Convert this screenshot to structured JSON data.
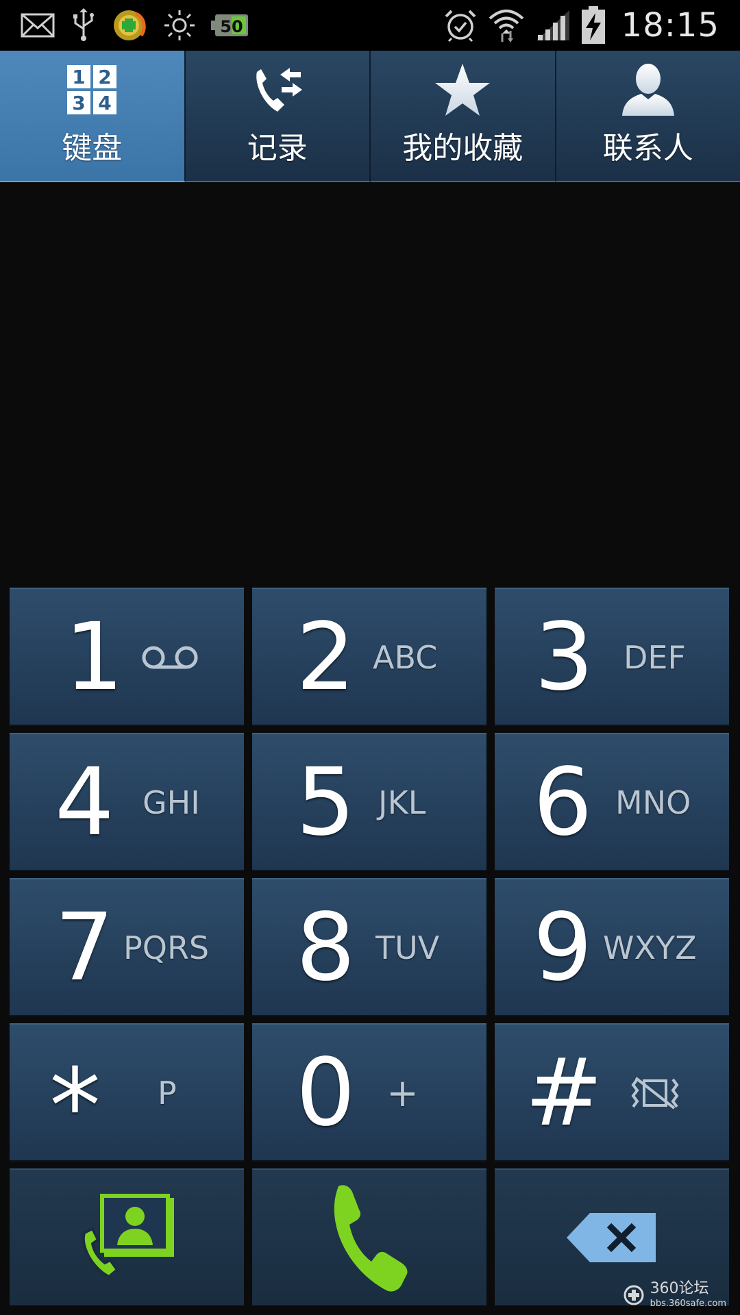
{
  "status_bar": {
    "time": "18:15",
    "left_icons": [
      "mail-icon",
      "usb-icon",
      "app-notification-icon",
      "brightness-icon",
      "battery-50-icon"
    ],
    "battery_label": "50",
    "right_icons": [
      "alarm-icon",
      "wifi-icon",
      "signal-icon",
      "battery-charging-icon"
    ]
  },
  "tabs": [
    {
      "label": "键盘",
      "icon": "keypad-icon",
      "active": true
    },
    {
      "label": "记录",
      "icon": "call-log-icon",
      "active": false
    },
    {
      "label": "我的收藏",
      "icon": "star-icon",
      "active": false
    },
    {
      "label": "联系人",
      "icon": "contact-icon",
      "active": false
    }
  ],
  "keypad_icon_digits": [
    "1",
    "2",
    "3",
    "4"
  ],
  "keys": [
    {
      "digit": "1",
      "letters": "",
      "sub_icon": "voicemail-icon"
    },
    {
      "digit": "2",
      "letters": "ABC"
    },
    {
      "digit": "3",
      "letters": "DEF"
    },
    {
      "digit": "4",
      "letters": "GHI"
    },
    {
      "digit": "5",
      "letters": "JKL"
    },
    {
      "digit": "6",
      "letters": "MNO"
    },
    {
      "digit": "7",
      "letters": "PQRS"
    },
    {
      "digit": "8",
      "letters": "TUV"
    },
    {
      "digit": "9",
      "letters": "WXYZ"
    },
    {
      "digit": "*",
      "letters": "P"
    },
    {
      "digit": "0",
      "letters": "+"
    },
    {
      "digit": "#",
      "letters": "",
      "sub_icon": "vibrate-off-icon"
    }
  ],
  "actions": [
    {
      "name": "add-to-contacts-button",
      "icon": "add-contact-icon"
    },
    {
      "name": "call-button",
      "icon": "phone-icon"
    },
    {
      "name": "backspace-button",
      "icon": "backspace-icon"
    }
  ],
  "watermark": {
    "text": "360论坛",
    "url": "bbs.360safe.com"
  },
  "colors": {
    "tab_active": "#4a82b4",
    "tab_inactive": "#213a54",
    "key_bg": "#2a4763",
    "call_green": "#7ed321",
    "backspace_blue": "#7fb6e6"
  }
}
